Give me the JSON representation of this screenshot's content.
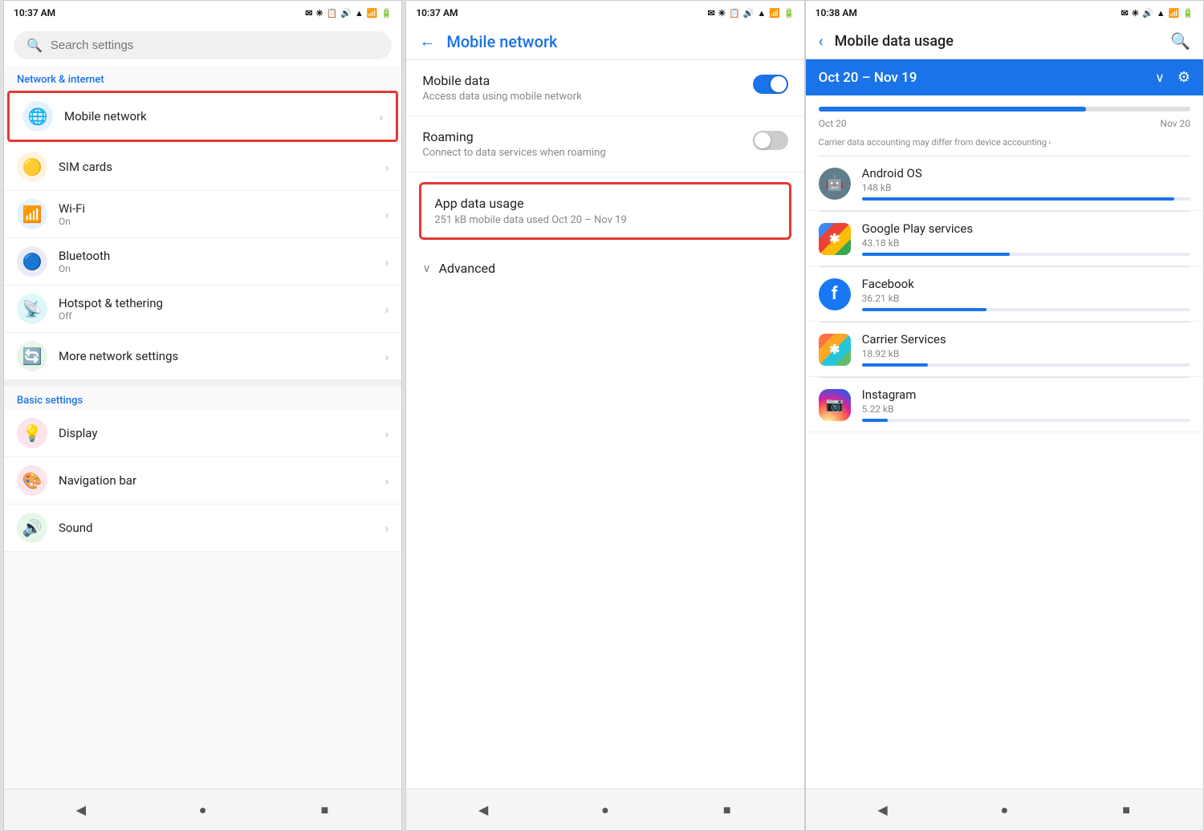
{
  "panel1": {
    "status_time": "10:37 AM",
    "search_placeholder": "Search settings",
    "section_network": "Network & internet",
    "section_basic": "Basic settings",
    "items_network": [
      {
        "id": "mobile-network",
        "label": "Mobile network",
        "sub": "",
        "icon": "🌐",
        "icon_color": "#1a73e8",
        "highlighted": true
      },
      {
        "id": "sim-cards",
        "label": "SIM cards",
        "sub": "",
        "icon": "🟡",
        "icon_color": "#fb8c00",
        "highlighted": false
      },
      {
        "id": "wifi",
        "label": "Wi-Fi",
        "sub": "On",
        "icon": "📶",
        "icon_color": "#1e88e5",
        "highlighted": false
      },
      {
        "id": "bluetooth",
        "label": "Bluetooth",
        "sub": "On",
        "icon": "🔵",
        "icon_color": "#1976d2",
        "highlighted": false
      },
      {
        "id": "hotspot",
        "label": "Hotspot & tethering",
        "sub": "Off",
        "icon": "📡",
        "icon_color": "#00acc1",
        "highlighted": false
      },
      {
        "id": "more-network",
        "label": "More network settings",
        "sub": "",
        "icon": "🔄",
        "icon_color": "#66bb6a",
        "highlighted": false
      }
    ],
    "items_basic": [
      {
        "id": "display",
        "label": "Display",
        "sub": "",
        "icon": "💡",
        "icon_color": "#e91e63"
      },
      {
        "id": "nav-bar",
        "label": "Navigation bar",
        "sub": "",
        "icon": "🎨",
        "icon_color": "#e91e63"
      },
      {
        "id": "sound",
        "label": "Sound",
        "sub": "",
        "icon": "🔊",
        "icon_color": "#43a047"
      }
    ],
    "nav_back": "◀",
    "nav_home": "●",
    "nav_recent": "■"
  },
  "panel2": {
    "status_time": "10:37 AM",
    "title": "Mobile network",
    "options": [
      {
        "id": "mobile-data",
        "title": "Mobile data",
        "sub": "Access data using mobile network",
        "has_toggle": true,
        "toggle_on": true
      },
      {
        "id": "roaming",
        "title": "Roaming",
        "sub": "Connect to data services when roaming",
        "has_toggle": true,
        "toggle_on": false
      }
    ],
    "app_data_usage_title": "App data usage",
    "app_data_usage_sub": "251 kB mobile data used Oct 20 – Nov 19",
    "advanced_label": "Advanced",
    "nav_back": "◀",
    "nav_home": "●",
    "nav_recent": "■"
  },
  "panel3": {
    "status_time": "10:38 AM",
    "title": "Mobile data usage",
    "date_range": "Oct 20 – Nov 19",
    "date_start": "Oct 20",
    "date_end": "Nov 20",
    "carrier_note": "Carrier data accounting may differ from device accounting",
    "usage_percent": 72,
    "apps": [
      {
        "id": "android-os",
        "name": "Android OS",
        "size": "148 kB",
        "percent": 95,
        "icon": "🤖",
        "color": "#607d8b"
      },
      {
        "id": "google-play",
        "name": "Google Play services",
        "size": "43.18 kB",
        "percent": 45,
        "icon": "✱",
        "color": "#4caf50"
      },
      {
        "id": "facebook",
        "name": "Facebook",
        "size": "36.21 kB",
        "percent": 38,
        "icon": "f",
        "color": "#1877f2"
      },
      {
        "id": "carrier-services",
        "name": "Carrier Services",
        "size": "18.92 kB",
        "percent": 20,
        "icon": "✱",
        "color": "#ff7043"
      },
      {
        "id": "instagram",
        "name": "Instagram",
        "size": "5.22 kB",
        "percent": 8,
        "icon": "📷",
        "color": "#c13584"
      }
    ],
    "nav_back": "◀",
    "nav_home": "●",
    "nav_recent": "■"
  }
}
